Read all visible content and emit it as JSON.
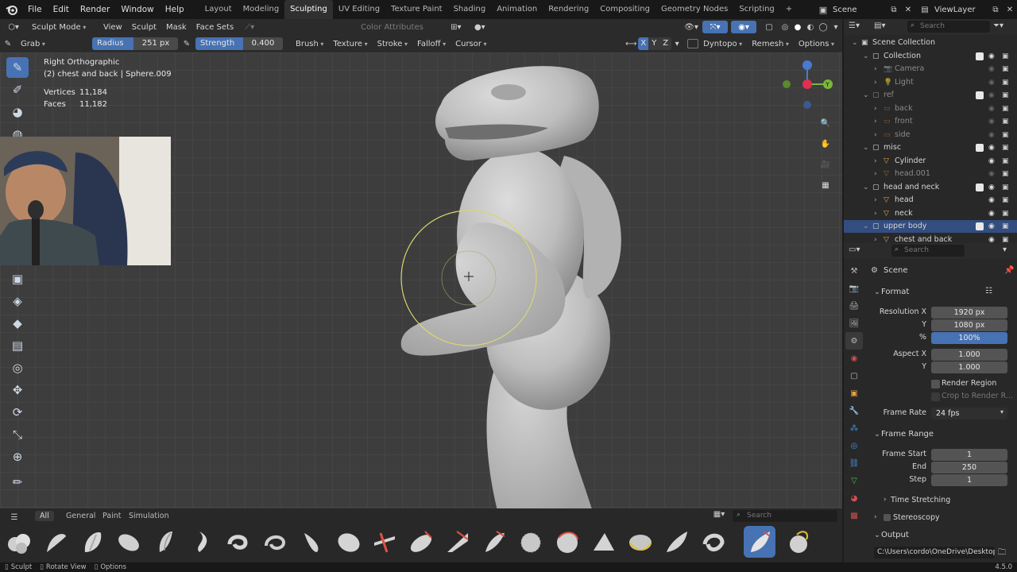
{
  "menu": {
    "items": [
      "File",
      "Edit",
      "Render",
      "Window",
      "Help"
    ],
    "workspaces": [
      "Layout",
      "Modeling",
      "Sculpting",
      "UV Editing",
      "Texture Paint",
      "Shading",
      "Animation",
      "Rendering",
      "Compositing",
      "Geometry Nodes",
      "Scripting"
    ],
    "active_workspace": "Sculpting",
    "plus": "+",
    "scene": "Scene",
    "view_layer": "ViewLayer"
  },
  "header1": {
    "mode": "Sculpt Mode",
    "view": "View",
    "sculpt": "Sculpt",
    "mask": "Mask",
    "face_sets": "Face Sets",
    "color_attributes": "Color Attributes"
  },
  "header2": {
    "brush_name": "Grab",
    "radius_label": "Radius",
    "radius_value": "251 px",
    "strength_label": "Strength",
    "strength_value": "0.400",
    "brush": "Brush",
    "texture": "Texture",
    "stroke": "Stroke",
    "falloff": "Falloff",
    "cursor": "Cursor",
    "x": "X",
    "y": "Y",
    "z": "Z",
    "dyntopo": "Dyntopo",
    "remesh": "Remesh",
    "options": "Options"
  },
  "viewport": {
    "view_name": "Right Orthographic",
    "object": "(2) chest and back | Sphere.009",
    "vertices_label": "Vertices",
    "vertices": "11,184",
    "faces_label": "Faces",
    "faces": "11,182"
  },
  "outliner": {
    "search": "Search",
    "rows": [
      {
        "label": "Scene Collection",
        "indent": 0,
        "kind": "scene"
      },
      {
        "label": "Collection",
        "indent": 1,
        "kind": "coll"
      },
      {
        "label": "Camera",
        "indent": 2,
        "kind": "cam",
        "dim": true
      },
      {
        "label": "Light",
        "indent": 2,
        "kind": "light",
        "dim": true
      },
      {
        "label": "ref",
        "indent": 1,
        "kind": "coll",
        "dim": true
      },
      {
        "label": "back",
        "indent": 2,
        "kind": "empty",
        "dim": true
      },
      {
        "label": "front",
        "indent": 2,
        "kind": "empty",
        "dim": true
      },
      {
        "label": "side",
        "indent": 2,
        "kind": "empty",
        "dim": true
      },
      {
        "label": "misc",
        "indent": 1,
        "kind": "coll"
      },
      {
        "label": "Cylinder",
        "indent": 2,
        "kind": "mesh"
      },
      {
        "label": "head.001",
        "indent": 2,
        "kind": "mesh",
        "dim": true
      },
      {
        "label": "head and neck",
        "indent": 1,
        "kind": "coll"
      },
      {
        "label": "head",
        "indent": 2,
        "kind": "mesh"
      },
      {
        "label": "neck",
        "indent": 2,
        "kind": "mesh"
      },
      {
        "label": "upper body",
        "indent": 1,
        "kind": "coll",
        "sel": true
      },
      {
        "label": "chest and back",
        "indent": 2,
        "kind": "mesh"
      }
    ]
  },
  "properties": {
    "search": "Search",
    "scene": "Scene",
    "format": "Format",
    "res_x_label": "Resolution X",
    "res_x": "1920 px",
    "res_y_label": "Y",
    "res_y": "1080 px",
    "pct_label": "%",
    "pct": "100%",
    "aspect_x_label": "Aspect X",
    "aspect_x": "1.000",
    "aspect_y_label": "Y",
    "aspect_y": "1.000",
    "render_region": "Render Region",
    "crop": "Crop to Render R...",
    "frame_rate_label": "Frame Rate",
    "frame_rate": "24 fps",
    "frame_range": "Frame Range",
    "start_label": "Frame Start",
    "start": "1",
    "end_label": "End",
    "end": "250",
    "step_label": "Step",
    "step": "1",
    "time_stretching": "Time Stretching",
    "stereoscopy": "Stereoscopy",
    "output": "Output",
    "output_path": "C:\\Users\\cordo\\OneDrive\\Desktop\\"
  },
  "brushbar": {
    "tabs": [
      "All",
      "General",
      "Paint",
      "Simulation"
    ],
    "search": "Search"
  },
  "status": {
    "sculpt": "Sculpt",
    "rotate": "Rotate View",
    "options": "Options",
    "version": "4.5.0"
  }
}
